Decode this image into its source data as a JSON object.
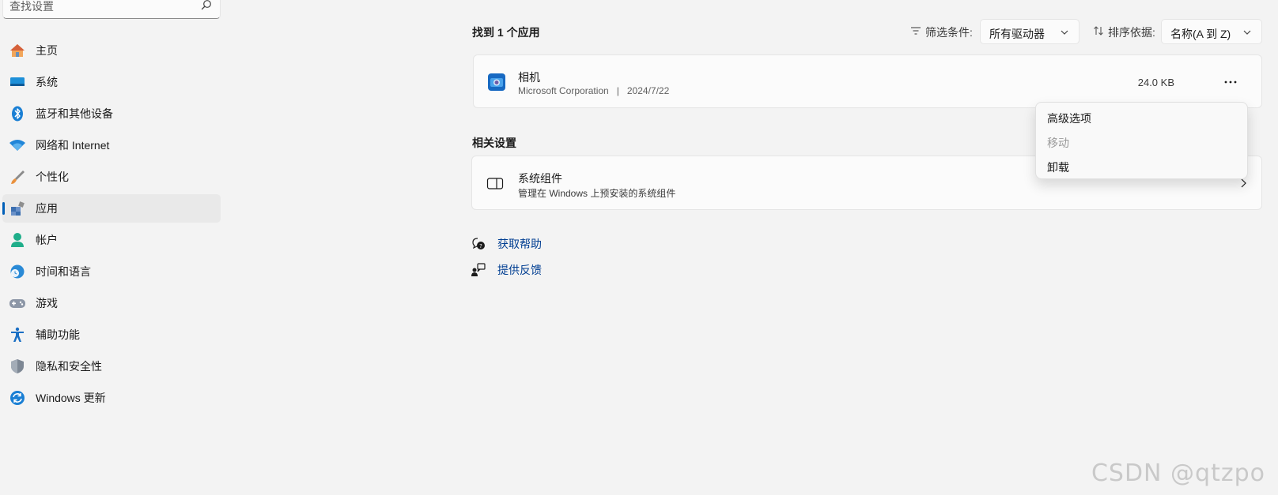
{
  "search": {
    "placeholder": "查找设置"
  },
  "sidebar": {
    "items": [
      {
        "label": "主页",
        "icon": "home-icon"
      },
      {
        "label": "系统",
        "icon": "system-icon"
      },
      {
        "label": "蓝牙和其他设备",
        "icon": "bluetooth-icon"
      },
      {
        "label": "网络和 Internet",
        "icon": "wifi-icon"
      },
      {
        "label": "个性化",
        "icon": "brush-icon"
      },
      {
        "label": "应用",
        "icon": "apps-icon",
        "active": true
      },
      {
        "label": "帐户",
        "icon": "account-icon"
      },
      {
        "label": "时间和语言",
        "icon": "globe-clock-icon"
      },
      {
        "label": "游戏",
        "icon": "gamepad-icon"
      },
      {
        "label": "辅助功能",
        "icon": "accessibility-icon"
      },
      {
        "label": "隐私和安全性",
        "icon": "shield-icon"
      },
      {
        "label": "Windows 更新",
        "icon": "update-icon"
      }
    ]
  },
  "header": {
    "found": "找到 1 个应用",
    "filter_label": "筛选条件:",
    "filter_value": "所有驱动器",
    "sort_label": "排序依据:",
    "sort_value": "名称(A 到 Z)"
  },
  "app": {
    "name": "相机",
    "publisher": "Microsoft Corporation",
    "separator": "|",
    "date": "2024/7/22",
    "size": "24.0 KB"
  },
  "context_menu": {
    "items": [
      {
        "label": "高级选项",
        "enabled": true
      },
      {
        "label": "移动",
        "enabled": false
      },
      {
        "label": "卸载",
        "enabled": true
      }
    ]
  },
  "related": {
    "title": "相关设置",
    "item_title": "系统组件",
    "item_desc": "管理在 Windows 上预安装的系统组件"
  },
  "links": {
    "help": "获取帮助",
    "feedback": "提供反馈"
  },
  "watermark": "CSDN @qtzpo",
  "colors": {
    "accent": "#005fb8",
    "link": "#003e92",
    "background": "#f3f3f3"
  }
}
